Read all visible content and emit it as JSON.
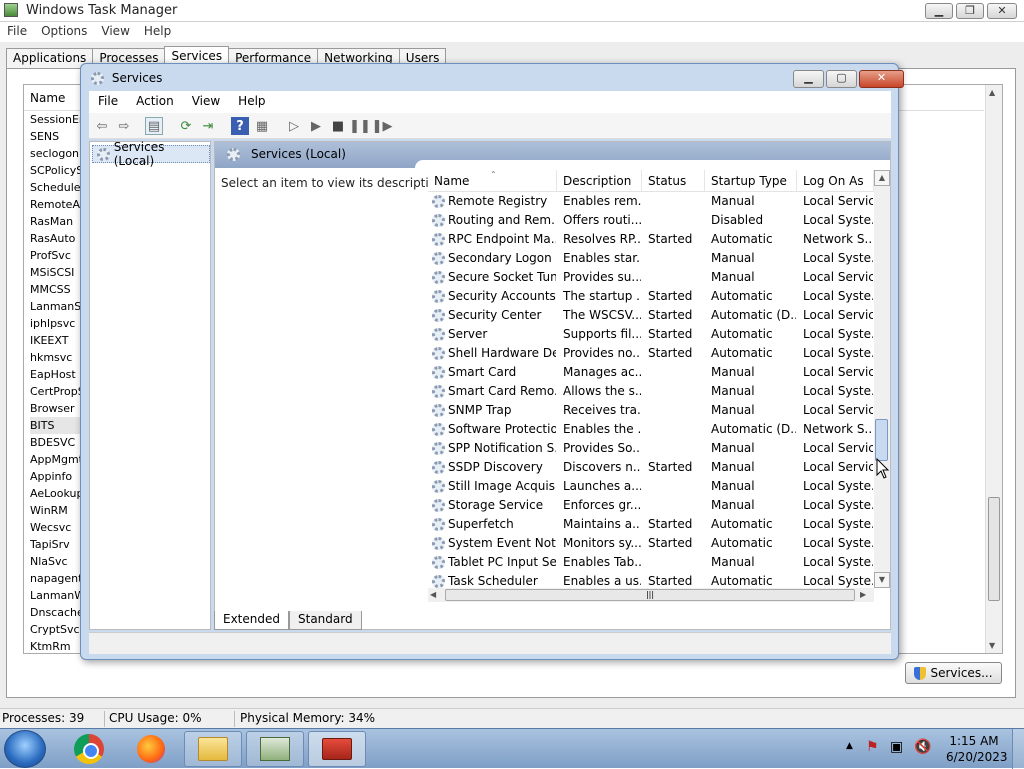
{
  "taskmgr": {
    "title": "Windows Task Manager",
    "menu": [
      "File",
      "Options",
      "View",
      "Help"
    ],
    "tabs": [
      "Applications",
      "Processes",
      "Services",
      "Performance",
      "Networking",
      "Users"
    ],
    "list_header": "Name",
    "service_names": [
      "SessionEnv",
      "SENS",
      "seclogon",
      "SCPolicySvc",
      "Schedule",
      "RemoteAccess",
      "RasMan",
      "RasAuto",
      "ProfSvc",
      "MSiSCSI",
      "MMCSS",
      "LanmanServer",
      "iphlpsvc",
      "IKEEXT",
      "hkmsvc",
      "EapHost",
      "CertPropSvc",
      "Browser",
      "BITS",
      "BDESVC",
      "AppMgmt",
      "Appinfo",
      "AeLookupSvc",
      "WinRM",
      "Wecsvc",
      "TapiSrv",
      "NlaSvc",
      "napagent",
      "LanmanWorkstation",
      "Dnscache",
      "CryptSvc",
      "KtmRm"
    ],
    "selected_index": 18,
    "services_button": "Services...",
    "status": {
      "processes": "Processes: 39",
      "cpu": "CPU Usage: 0%",
      "memory": "Physical Memory: 34%"
    }
  },
  "services_window": {
    "title": "Services",
    "menu": [
      "File",
      "Action",
      "View",
      "Help"
    ],
    "tree_item": "Services (Local)",
    "header": "Services (Local)",
    "description_prompt": "Select an item to view its description.",
    "columns": [
      "Name",
      "Description",
      "Status",
      "Startup Type",
      "Log On As"
    ],
    "rows": [
      [
        "Remote Registry",
        "Enables rem...",
        "",
        "Manual",
        "Local Service"
      ],
      [
        "Routing and Rem...",
        "Offers routi...",
        "",
        "Disabled",
        "Local Syste..."
      ],
      [
        "RPC Endpoint Ma...",
        "Resolves RP...",
        "Started",
        "Automatic",
        "Network S..."
      ],
      [
        "Secondary Logon",
        "Enables star...",
        "",
        "Manual",
        "Local Syste..."
      ],
      [
        "Secure Socket Tun...",
        "Provides su...",
        "",
        "Manual",
        "Local Service"
      ],
      [
        "Security Accounts...",
        "The startup ...",
        "Started",
        "Automatic",
        "Local Syste..."
      ],
      [
        "Security Center",
        "The WSCSV...",
        "Started",
        "Automatic (D...",
        "Local Service"
      ],
      [
        "Server",
        "Supports fil...",
        "Started",
        "Automatic",
        "Local Syste..."
      ],
      [
        "Shell Hardware De...",
        "Provides no...",
        "Started",
        "Automatic",
        "Local Syste..."
      ],
      [
        "Smart Card",
        "Manages ac...",
        "",
        "Manual",
        "Local Service"
      ],
      [
        "Smart Card Remo...",
        "Allows the s...",
        "",
        "Manual",
        "Local Syste..."
      ],
      [
        "SNMP Trap",
        "Receives tra...",
        "",
        "Manual",
        "Local Service"
      ],
      [
        "Software Protection",
        "Enables the ...",
        "",
        "Automatic (D...",
        "Network S..."
      ],
      [
        "SPP Notification S...",
        "Provides So...",
        "",
        "Manual",
        "Local Service"
      ],
      [
        "SSDP Discovery",
        "Discovers n...",
        "Started",
        "Manual",
        "Local Service"
      ],
      [
        "Still Image Acquisi...",
        "Launches a...",
        "",
        "Manual",
        "Local Syste..."
      ],
      [
        "Storage Service",
        "Enforces gr...",
        "",
        "Manual",
        "Local Syste..."
      ],
      [
        "Superfetch",
        "Maintains a...",
        "Started",
        "Automatic",
        "Local Syste..."
      ],
      [
        "System Event Noti...",
        "Monitors sy...",
        "Started",
        "Automatic",
        "Local Syste..."
      ],
      [
        "Tablet PC Input Se...",
        "Enables Tab...",
        "",
        "Manual",
        "Local Syste..."
      ],
      [
        "Task Scheduler",
        "Enables a us...",
        "Started",
        "Automatic",
        "Local Syste..."
      ]
    ],
    "view_tabs": [
      "Extended",
      "Standard"
    ]
  },
  "taskbar": {
    "time": "1:15 AM",
    "date": "6/20/2023"
  }
}
